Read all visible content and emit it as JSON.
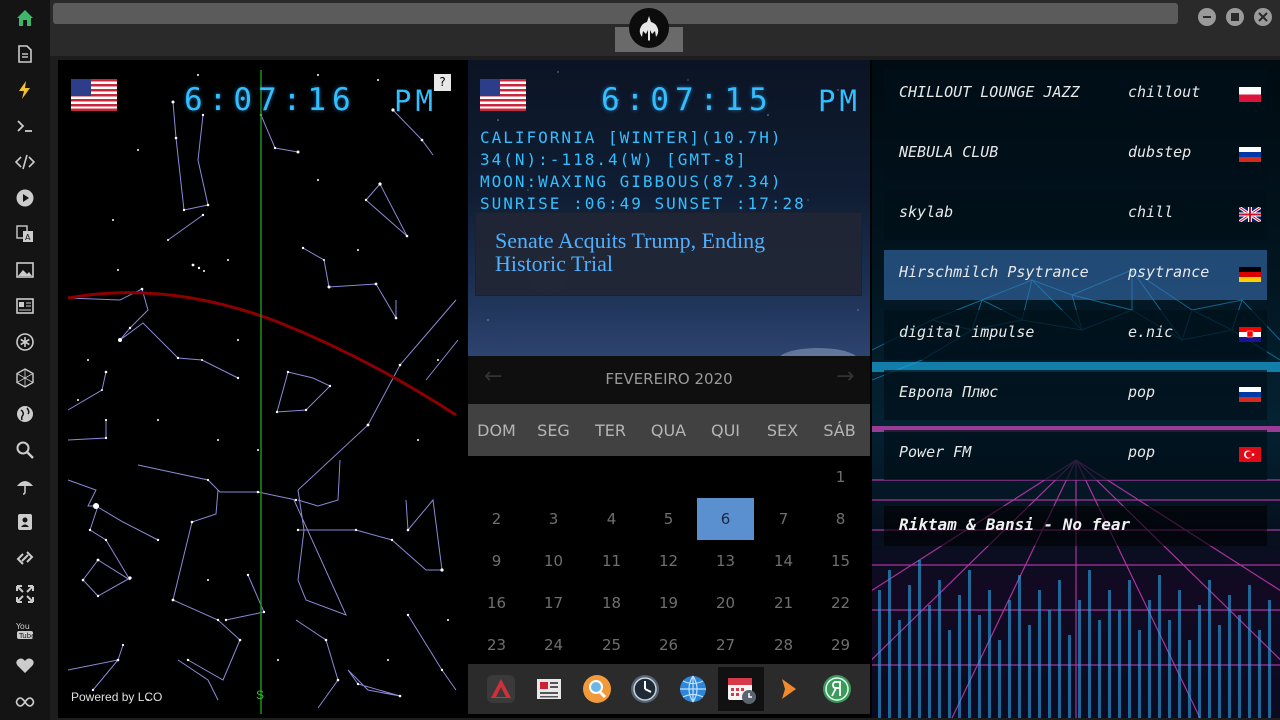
{
  "sidebar": {
    "items": [
      {
        "icon": "home-icon"
      },
      {
        "icon": "document-icon"
      },
      {
        "icon": "lightning-icon"
      },
      {
        "icon": "terminal-icon"
      },
      {
        "icon": "code-icon"
      },
      {
        "icon": "play-icon"
      },
      {
        "icon": "translate-icon"
      },
      {
        "icon": "image-icon"
      },
      {
        "icon": "news-icon"
      },
      {
        "icon": "asterisk-icon"
      },
      {
        "icon": "hexagon-icon"
      },
      {
        "icon": "globe-icon"
      },
      {
        "icon": "search-icon"
      },
      {
        "icon": "umbrella-icon"
      },
      {
        "icon": "contact-icon"
      },
      {
        "icon": "link-icon"
      },
      {
        "icon": "expand-icon"
      },
      {
        "icon": "youtube-icon"
      },
      {
        "icon": "heart-icon"
      },
      {
        "icon": "infinity-icon"
      }
    ]
  },
  "topbar": {
    "emblem": "rebel-alliance-icon",
    "window_buttons": [
      "minimize-icon",
      "maximize-icon",
      "close-icon"
    ]
  },
  "sky_clock": {
    "time": "6:07:16",
    "ampm": "PM",
    "help_label": "?",
    "powered_by": "Powered by LCO",
    "compass": "S"
  },
  "location_clock": {
    "time": "6:07:15",
    "ampm": "PM",
    "location_line": "CALIFORNIA [WINTER](10.7H)",
    "coords_line": "34(N):-118.4(W) [GMT-8]",
    "moon_line": "MOON:WAXING GIBBOUS(87.34)",
    "sun_line": "SUNRISE_:06:49 SUNSET_:17:28",
    "news_headline": "Senate Acquits Trump, Ending Historic Trial"
  },
  "calendar": {
    "month_label": "FEVEREIRO 2020",
    "weekdays": [
      "DOM",
      "SEG",
      "TER",
      "QUA",
      "QUI",
      "SEX",
      "SÁB"
    ],
    "today": 6,
    "days": [
      1,
      2,
      3,
      4,
      5,
      6,
      7,
      8,
      9,
      10,
      11,
      12,
      13,
      14,
      15,
      16,
      17,
      18,
      19,
      20,
      21,
      22,
      23,
      24,
      25,
      26,
      27,
      28,
      29
    ]
  },
  "dock": {
    "items": [
      "vivaldi-icon",
      "news-reader-icon",
      "search-icon",
      "clock-icon",
      "globe-icon",
      "calendar-icon",
      "arrow-icon",
      "yandex-icon"
    ],
    "active_index": 5
  },
  "radio": {
    "stations": [
      {
        "name": "CHILLOUT LOUNGE JAZZ",
        "genre": "chillout",
        "flag": "poland"
      },
      {
        "name": "NEBULA CLUB",
        "genre": "dubstep",
        "flag": "russia"
      },
      {
        "name": "skylab",
        "genre": "chill",
        "flag": "uk"
      },
      {
        "name": "Hirschmilch Psytrance",
        "genre": "psytrance",
        "flag": "germany"
      },
      {
        "name": "digital impulse",
        "genre": "e.nic",
        "flag": "croatia"
      },
      {
        "name": "Европа Плюс",
        "genre": "pop",
        "flag": "russia"
      },
      {
        "name": "Power FM",
        "genre": "pop",
        "flag": "turkey"
      }
    ],
    "active_index": 3,
    "now_playing": "Riktam & Bansi - No fear"
  },
  "colors": {
    "clock": "#33bfff",
    "today": "#5a8fd0",
    "horizon": "#8b0000",
    "meridian": "#1f8f1f",
    "constellation": "#8a8ad8"
  }
}
